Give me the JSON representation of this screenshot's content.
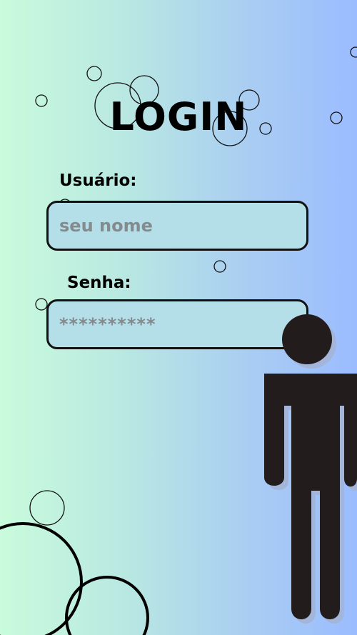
{
  "login": {
    "title": "LOGIN",
    "username_label": "Usuário:",
    "username_placeholder": "seu nome",
    "username_value": "",
    "password_label": "Senha:",
    "password_placeholder": "**********",
    "password_value": ""
  },
  "decoration": {
    "illustration": "person-icon",
    "background_gradient": [
      "#c9fbdc",
      "#9bbcff"
    ],
    "field_fill": "#b4dfe9",
    "figure_color": "#231c1c"
  }
}
